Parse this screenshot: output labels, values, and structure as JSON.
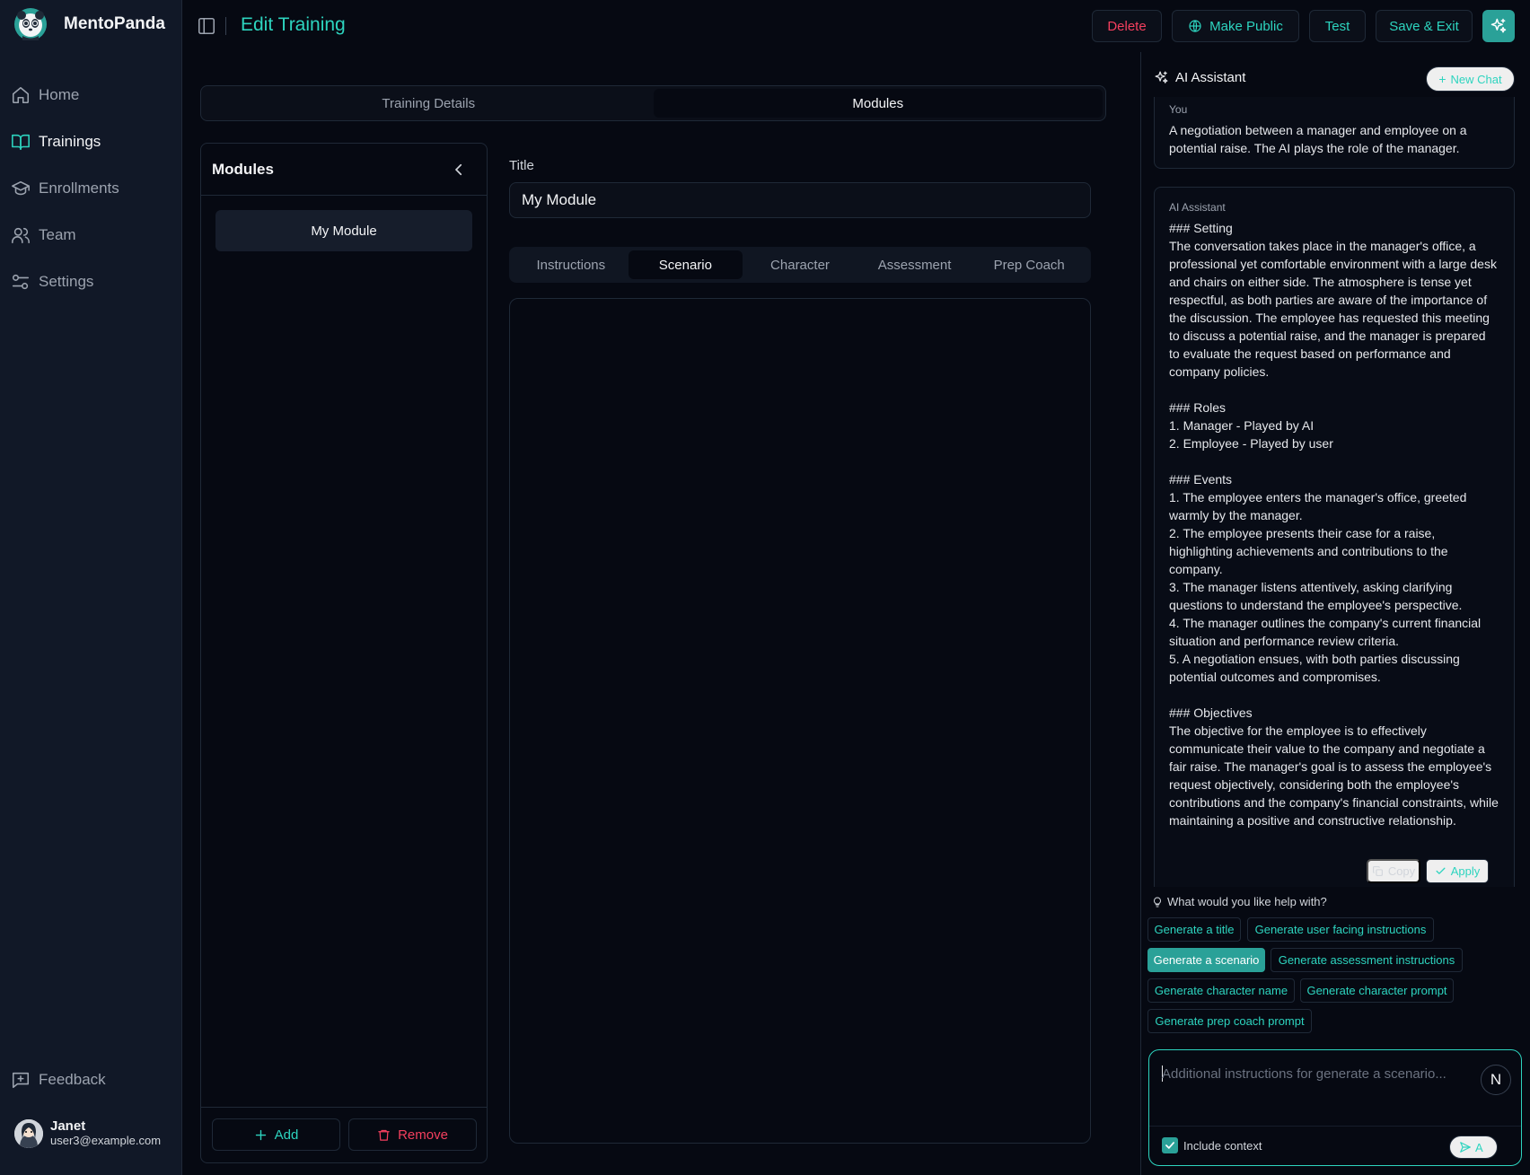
{
  "app": {
    "name": "MentoPanda"
  },
  "sidebar": {
    "items": [
      {
        "label": "Home",
        "icon": "home-icon"
      },
      {
        "label": "Trainings",
        "icon": "book-icon",
        "active": true
      },
      {
        "label": "Enrollments",
        "icon": "graduation-cap-icon"
      },
      {
        "label": "Team",
        "icon": "users-icon"
      },
      {
        "label": "Settings",
        "icon": "sliders-icon"
      }
    ],
    "feedback_label": "Feedback",
    "user": {
      "name": "Janet",
      "email": "user3@example.com"
    }
  },
  "header": {
    "title": "Edit Training",
    "buttons": {
      "delete": "Delete",
      "make_public": "Make Public",
      "test": "Test",
      "save_exit": "Save & Exit"
    }
  },
  "main_tabs": [
    {
      "label": "Training Details"
    },
    {
      "label": "Modules",
      "active": true
    }
  ],
  "modules": {
    "title": "Modules",
    "items": [
      "My Module"
    ],
    "add_label": "Add",
    "remove_label": "Remove"
  },
  "editor": {
    "title_label": "Title",
    "title_value": "My Module",
    "tabs": [
      {
        "label": "Instructions"
      },
      {
        "label": "Scenario",
        "active": true
      },
      {
        "label": "Character"
      },
      {
        "label": "Assessment"
      },
      {
        "label": "Prep Coach"
      }
    ]
  },
  "assistant": {
    "title": "AI Assistant",
    "new_chat": "New Chat",
    "you_label": "You",
    "you_message": "A negotiation between a manager and employee on a potential raise. The AI plays the role of the manager.",
    "ai_label": "AI Assistant",
    "ai_message": "### Setting\nThe conversation takes place in the manager's office, a professional yet comfortable environment with a large desk and chairs on either side. The atmosphere is tense yet respectful, as both parties are aware of the importance of the discussion. The employee has requested this meeting to discuss a potential raise, and the manager is prepared to evaluate the request based on performance and company policies.\n\n### Roles\n1. Manager - Played by AI\n2. Employee - Played by user\n\n### Events\n1. The employee enters the manager's office, greeted warmly by the manager.\n2. The employee presents their case for a raise, highlighting achievements and contributions to the company.\n3. The manager listens attentively, asking clarifying questions to understand the employee's perspective.\n4. The manager outlines the company's current financial situation and performance review criteria.\n5. A negotiation ensues, with both parties discussing potential outcomes and compromises.\n\n### Objectives\nThe objective for the employee is to effectively communicate their value to the company and negotiate a fair raise. The manager's goal is to assess the employee's request objectively, considering both the employee's contributions and the company's financial constraints, while maintaining a positive and constructive relationship.",
    "copy_label": "Copy",
    "apply_label": "Apply",
    "help_label": "What would you like help with?",
    "suggestions": [
      "Generate a title",
      "Generate user facing instructions",
      "Generate a scenario",
      "Generate assessment instructions",
      "Generate character name",
      "Generate character prompt",
      "Generate prep coach prompt"
    ],
    "input_placeholder": "Additional instructions for generate a scenario...",
    "include_context_label": "Include context",
    "send_label": "A",
    "user_initial": "N"
  },
  "colors": {
    "accent": "#2dd4bf",
    "accent_solid": "#2aa198",
    "danger": "#f43f5e",
    "background": "#060912",
    "sidebar": "#111827"
  }
}
